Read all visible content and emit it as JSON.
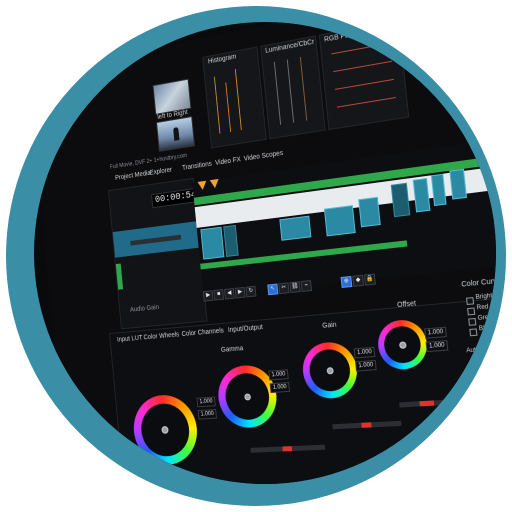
{
  "app": {
    "panels": {
      "histogram_label": "Histogram",
      "luminance_label": "Luminance/CbCr",
      "rgb_parade_label": "RGB Parade"
    },
    "left": {
      "thumb_caption": "left to Right",
      "file_info": "Full Movie, DVF  2+ 1+hostbry.com",
      "tabs": [
        "Project Media",
        "Explorer",
        "Transitions",
        "Video FX",
        "Video Scopes"
      ],
      "timecode": "00:00:54:07",
      "label": "Audio Gain"
    },
    "colorgrading": {
      "tabs": [
        "Input LUT",
        "Color Wheels",
        "Color Channels",
        "Input/Output"
      ],
      "labels": {
        "gamma": "Gamma",
        "gain": "Gain",
        "offset": "Offset",
        "color_curves": "Color Curves",
        "auto_color": "Auto Color Balance"
      },
      "field_values": [
        "1.000",
        "1.000",
        "1.000",
        "1.000",
        "1.000",
        "1.000",
        "1.000",
        "1.000"
      ],
      "checkbox_labels": [
        "Brightness",
        "Red",
        "Green",
        "Blue"
      ],
      "auto_level_label": "Auto Level"
    },
    "colors": {
      "ring": "#3a8fa7",
      "timeline_green": "#2ea84a",
      "clip_blue": "#2b8aa3",
      "accent_orange": "#f2a52b",
      "slider_red": "#e8302a",
      "tool_active": "#2b6fd6"
    }
  }
}
